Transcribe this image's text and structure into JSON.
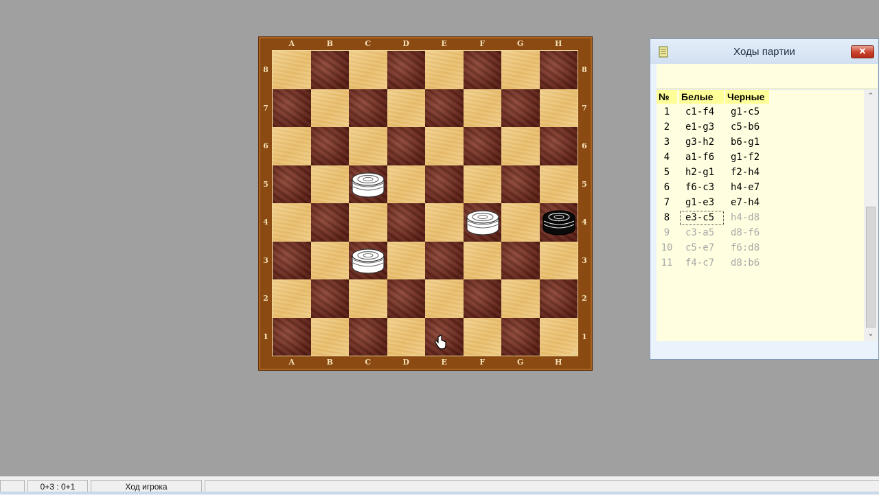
{
  "board": {
    "files_top": [
      "A",
      "B",
      "C",
      "D",
      "E",
      "F",
      "G",
      "H"
    ],
    "files_bottom": [
      "A",
      "B",
      "C",
      "D",
      "E",
      "F",
      "G",
      "H"
    ],
    "ranks": [
      "8",
      "7",
      "6",
      "5",
      "4",
      "3",
      "2",
      "1"
    ],
    "pieces": [
      {
        "square": "c5",
        "color": "white"
      },
      {
        "square": "f4",
        "color": "white"
      },
      {
        "square": "h4",
        "color": "black"
      },
      {
        "square": "c3",
        "color": "white"
      }
    ],
    "colors": {
      "frame": "#8a4a12",
      "light": "#ecc57a",
      "dark": "#6a2a20"
    }
  },
  "moves_window": {
    "title": "Ходы партии",
    "close_glyph": "✕",
    "headers": {
      "num": "№",
      "white": "Белые",
      "black": "Черные"
    },
    "rows": [
      {
        "num": "1",
        "white": "c1-f4",
        "black": "g1-c5"
      },
      {
        "num": "2",
        "white": "e1-g3",
        "black": "c5-b6"
      },
      {
        "num": "3",
        "white": "g3-h2",
        "black": "b6-g1"
      },
      {
        "num": "4",
        "white": "a1-f6",
        "black": "g1-f2"
      },
      {
        "num": "5",
        "white": "h2-g1",
        "black": "f2-h4"
      },
      {
        "num": "6",
        "white": "f6-c3",
        "black": "h4-e7"
      },
      {
        "num": "7",
        "white": "g1-e3",
        "black": "e7-h4"
      },
      {
        "num": "8",
        "white": "e3-c5",
        "black": "h4-d8"
      },
      {
        "num": "9",
        "white": "c3-a5",
        "black": "d8-f6"
      },
      {
        "num": "10",
        "white": "c5-e7",
        "black": "f6:d8"
      },
      {
        "num": "11",
        "white": "f4-c7",
        "black": "d8:b6"
      }
    ],
    "played_half_moves": 15,
    "scroll_up": "⌃",
    "scroll_down": "⌄"
  },
  "statusbar": {
    "score": "0+3 : 0+1",
    "status": "Ход игрока"
  }
}
